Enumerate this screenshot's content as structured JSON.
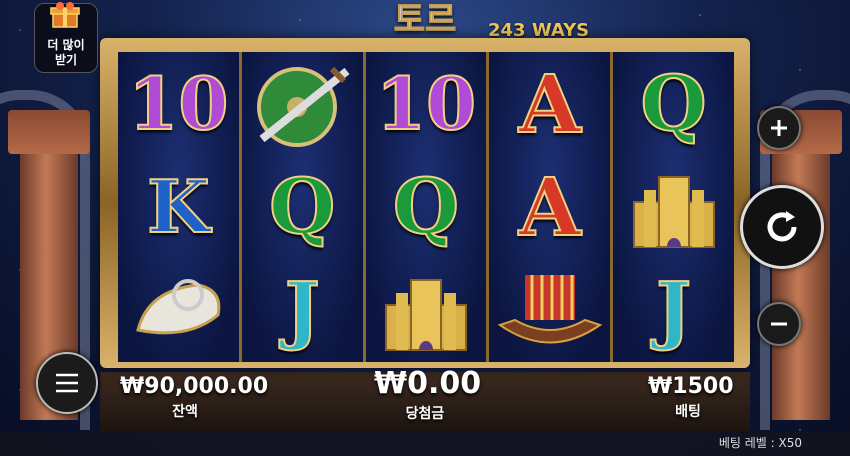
{
  "game": {
    "title": "토르",
    "ways_label": "243 WAYS"
  },
  "promo": {
    "label_line1": "더 많이",
    "label_line2": "받기",
    "icon": "gift-icon"
  },
  "reels": [
    [
      "10",
      "shield-sword",
      "A"
    ],
    [
      "K",
      "Q",
      "J"
    ],
    [
      "10",
      "Q",
      "golden-castle"
    ],
    [
      "A",
      "A",
      "viking-ship"
    ],
    [
      "Q",
      "golden-castle",
      "J"
    ]
  ],
  "reel_grid_display": [
    [
      "10",
      "shield-sword",
      "10",
      "A",
      "Q"
    ],
    [
      "K",
      "Q",
      "Q",
      "A",
      "golden-castle"
    ],
    [
      "drinking-horn",
      "J",
      "golden-castle",
      "viking-ship",
      "J"
    ]
  ],
  "stats": {
    "balance_value": "₩90,000.00",
    "balance_label": "잔액",
    "win_value": "₩0.00",
    "win_label": "당첨금",
    "bet_value": "₩1500",
    "bet_label": "배팅"
  },
  "bet_level": "베팅 레벨 : X50",
  "controls": {
    "plus_icon": "plus-icon",
    "minus_icon": "minus-icon",
    "spin_icon": "spin-icon",
    "menu_icon": "menu-icon"
  }
}
